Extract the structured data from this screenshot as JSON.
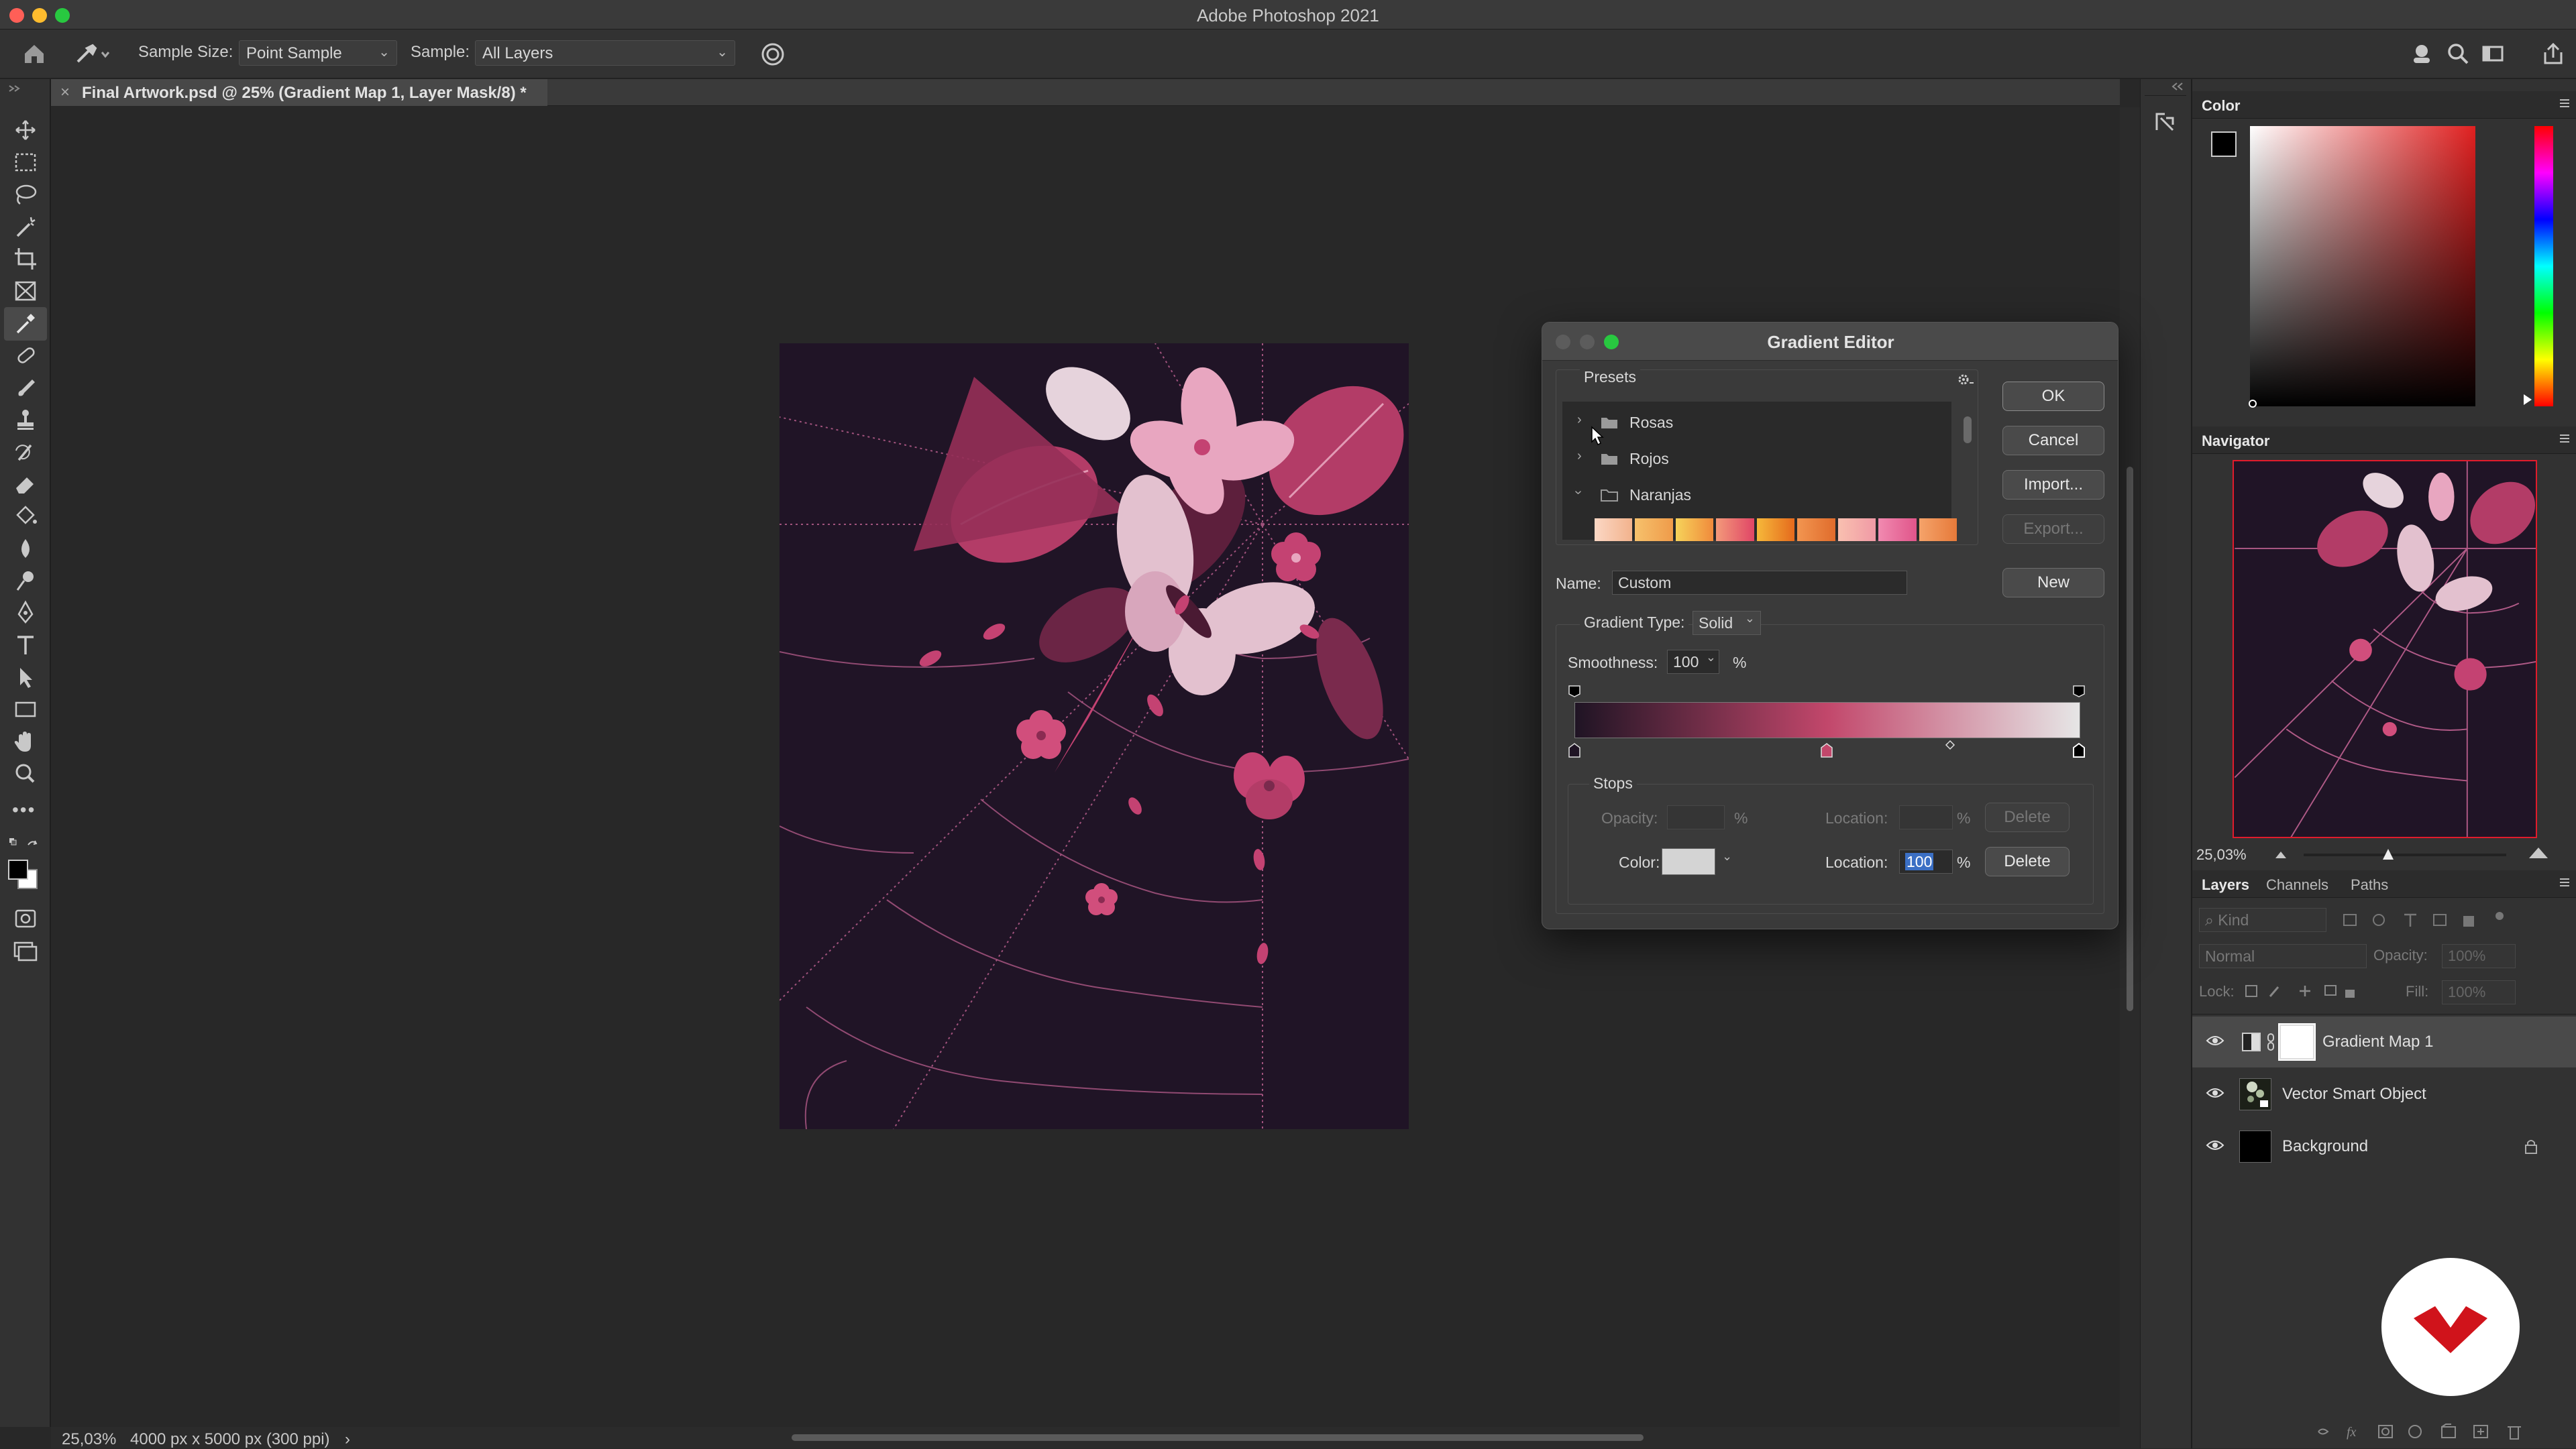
{
  "app": {
    "title": "Adobe Photoshop 2021"
  },
  "options_bar": {
    "sample_size_label": "Sample Size:",
    "sample_size_value": "Point Sample",
    "sample_label": "Sample:",
    "sample_value": "All Layers"
  },
  "document": {
    "tab_label": "Final Artwork.psd @ 25% (Gradient Map 1, Layer Mask/8) *"
  },
  "status_bar": {
    "zoom": "25,03%",
    "doc_info": "4000 px x 5000 px (300 ppi)",
    "arrow": "›"
  },
  "gradient_editor": {
    "title": "Gradient Editor",
    "presets_label": "Presets",
    "preset_folders": [
      {
        "name": "Rosas",
        "expanded": false
      },
      {
        "name": "Rojos",
        "expanded": false
      },
      {
        "name": "Naranjas",
        "expanded": true
      }
    ],
    "buttons": {
      "ok": "OK",
      "cancel": "Cancel",
      "import": "Import...",
      "export": "Export...",
      "new": "New",
      "delete_opacity": "Delete",
      "delete_color": "Delete"
    },
    "name_label": "Name:",
    "name_value": "Custom",
    "gradient_type_label": "Gradient Type:",
    "gradient_type_value": "Solid",
    "smoothness_label": "Smoothness:",
    "smoothness_value": "100",
    "percent": "%",
    "stops_label": "Stops",
    "opacity_label": "Opacity:",
    "opacity_value": "",
    "location_label": "Location:",
    "opacity_location_value": "",
    "color_label": "Color:",
    "color_location_value": "100",
    "selected_stop_color": "#d4d4d4",
    "gradient_colors": [
      "#1f1424",
      "#c2476b",
      "#e6e6e6"
    ]
  },
  "color_panel": {
    "title": "Color",
    "foreground": "#000000",
    "background": "#ffffff"
  },
  "navigator_panel": {
    "title": "Navigator",
    "zoom": "25,03%"
  },
  "layers_panel": {
    "tabs": [
      "Layers",
      "Channels",
      "Paths"
    ],
    "filter_placeholder": "Kind",
    "blend_mode": "Normal",
    "opacity_label": "Opacity:",
    "opacity_value": "100%",
    "lock_label": "Lock:",
    "fill_label": "Fill:",
    "fill_value": "100%",
    "layers": [
      {
        "name": "Gradient Map 1",
        "selected": true
      },
      {
        "name": "Vector Smart Object",
        "selected": false
      },
      {
        "name": "Background",
        "selected": false,
        "locked": true
      }
    ]
  }
}
